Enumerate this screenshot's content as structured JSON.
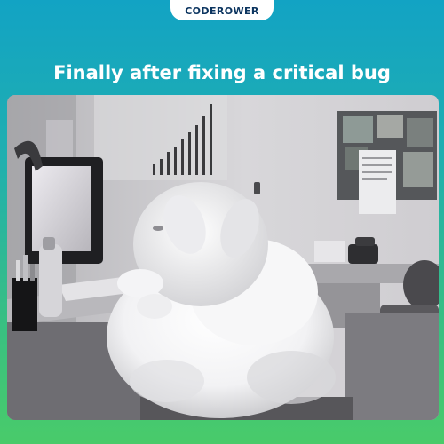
{
  "brand": {
    "logo_text": "CODEROWER"
  },
  "headline": "Finally after fixing a critical bug",
  "colors": {
    "gradient_top": "#12a3c4",
    "gradient_bottom": "#49cb6a",
    "logo_tab_bg": "#ffffff",
    "logo_text": "#0c3560",
    "headline_text": "#ffffff"
  },
  "photo": {
    "subject": "white-fluffy-bunny-at-desk-icon"
  }
}
